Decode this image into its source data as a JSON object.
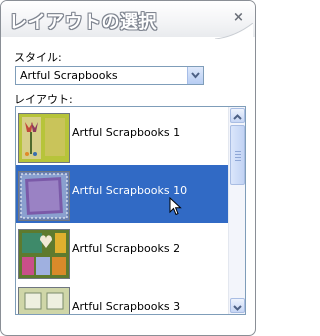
{
  "panel": {
    "title": "レイアウトの選択",
    "close_glyph": "×"
  },
  "style": {
    "label": "スタイル:",
    "selected": "Artful Scrapbooks"
  },
  "layout": {
    "label": "レイアウト:",
    "items": [
      {
        "label": "Artful Scrapbooks 1",
        "selected": false
      },
      {
        "label": "Artful Scrapbooks 10",
        "selected": true
      },
      {
        "label": "Artful Scrapbooks 2",
        "selected": false
      },
      {
        "label": "Artful Scrapbooks 3",
        "selected": false
      }
    ]
  },
  "colors": {
    "selection": "#316ac5",
    "border": "#7f9db9"
  }
}
